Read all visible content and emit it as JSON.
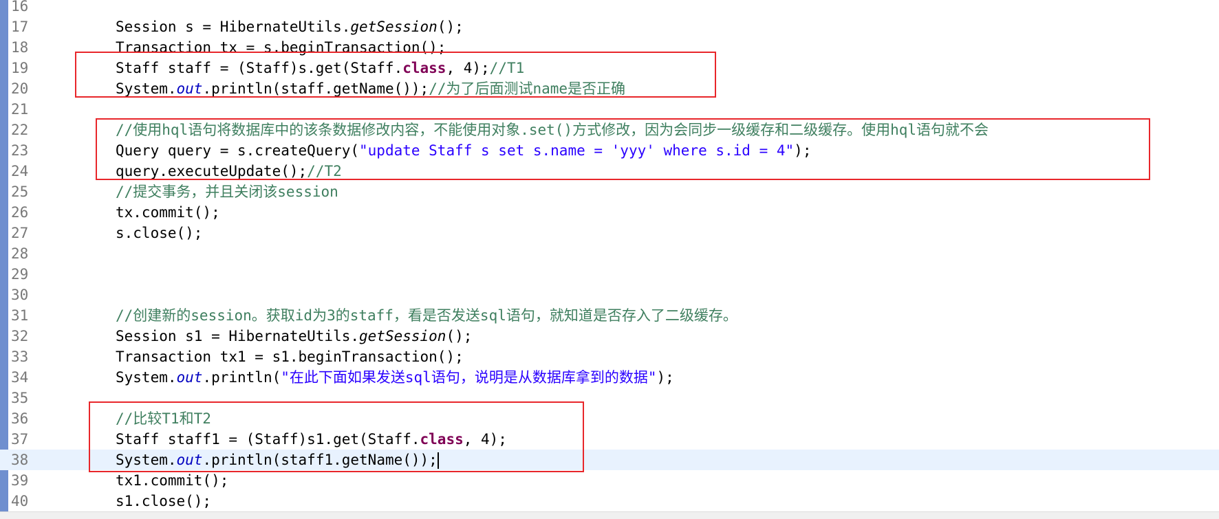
{
  "editor": {
    "lines": [
      {
        "num": "16",
        "segs": []
      },
      {
        "num": "17",
        "segs": [
          {
            "c": "",
            "t": "Session s = HibernateUtils."
          },
          {
            "c": "static",
            "t": "getSession"
          },
          {
            "c": "",
            "t": "();"
          }
        ]
      },
      {
        "num": "18",
        "segs": [
          {
            "c": "",
            "t": "Transaction tx = s.beginTransaction();"
          }
        ]
      },
      {
        "num": "19",
        "segs": [
          {
            "c": "",
            "t": "Staff staff = (Staff)s.get(Staff."
          },
          {
            "c": "kw",
            "t": "class"
          },
          {
            "c": "",
            "t": ", 4);"
          },
          {
            "c": "cmt",
            "t": "//T1"
          }
        ]
      },
      {
        "num": "20",
        "segs": [
          {
            "c": "",
            "t": "System."
          },
          {
            "c": "field",
            "t": "out"
          },
          {
            "c": "",
            "t": ".println(staff.getName());"
          },
          {
            "c": "cmt",
            "t": "//为了后面测试name是否正确"
          }
        ]
      },
      {
        "num": "21",
        "segs": []
      },
      {
        "num": "22",
        "segs": [
          {
            "c": "cmt",
            "t": "//使用hql语句将数据库中的该条数据修改内容，不能使用对象.set()方式修改，因为会同步一级缓存和二级缓存。使用hql语句就不会"
          }
        ]
      },
      {
        "num": "23",
        "segs": [
          {
            "c": "",
            "t": "Query query = s.createQuery("
          },
          {
            "c": "str",
            "t": "\"update Staff s set s.name = 'yyy' where s.id = 4\""
          },
          {
            "c": "",
            "t": ");"
          }
        ]
      },
      {
        "num": "24",
        "segs": [
          {
            "c": "",
            "t": "query.executeUpdate();"
          },
          {
            "c": "cmt",
            "t": "//T2"
          }
        ]
      },
      {
        "num": "25",
        "segs": [
          {
            "c": "cmt",
            "t": "//提交事务，并且关闭该session"
          }
        ]
      },
      {
        "num": "26",
        "segs": [
          {
            "c": "",
            "t": "tx.commit();"
          }
        ]
      },
      {
        "num": "27",
        "segs": [
          {
            "c": "",
            "t": "s.close();"
          }
        ]
      },
      {
        "num": "28",
        "segs": []
      },
      {
        "num": "29",
        "segs": []
      },
      {
        "num": "30",
        "segs": []
      },
      {
        "num": "31",
        "segs": [
          {
            "c": "cmt",
            "t": "//创建新的session。获取id为3的staff，看是否发送sql语句，就知道是否存入了二级缓存。"
          }
        ]
      },
      {
        "num": "32",
        "segs": [
          {
            "c": "",
            "t": "Session s1 = HibernateUtils."
          },
          {
            "c": "static",
            "t": "getSession"
          },
          {
            "c": "",
            "t": "();"
          }
        ]
      },
      {
        "num": "33",
        "segs": [
          {
            "c": "",
            "t": "Transaction tx1 = s1.beginTransaction();"
          }
        ]
      },
      {
        "num": "34",
        "segs": [
          {
            "c": "",
            "t": "System."
          },
          {
            "c": "field",
            "t": "out"
          },
          {
            "c": "",
            "t": ".println("
          },
          {
            "c": "str",
            "t": "\"在此下面如果发送sql语句，说明是从数据库拿到的数据\""
          },
          {
            "c": "",
            "t": ");"
          }
        ]
      },
      {
        "num": "35",
        "segs": []
      },
      {
        "num": "36",
        "segs": [
          {
            "c": "cmt",
            "t": "//比较T1和T2"
          }
        ]
      },
      {
        "num": "37",
        "segs": [
          {
            "c": "",
            "t": "Staff staff1 = (Staff)s1.get(Staff."
          },
          {
            "c": "kw",
            "t": "class"
          },
          {
            "c": "",
            "t": ", 4);"
          }
        ]
      },
      {
        "num": "38",
        "segs": [
          {
            "c": "",
            "t": "System."
          },
          {
            "c": "field",
            "t": "out"
          },
          {
            "c": "",
            "t": ".println(staff1.getName());"
          }
        ]
      },
      {
        "num": "39",
        "segs": [
          {
            "c": "",
            "t": "tx1.commit();"
          }
        ]
      },
      {
        "num": "40",
        "segs": [
          {
            "c": "",
            "t": "s1.close();"
          }
        ]
      }
    ],
    "current_line": "38",
    "highlight_color": "#e8262a"
  }
}
